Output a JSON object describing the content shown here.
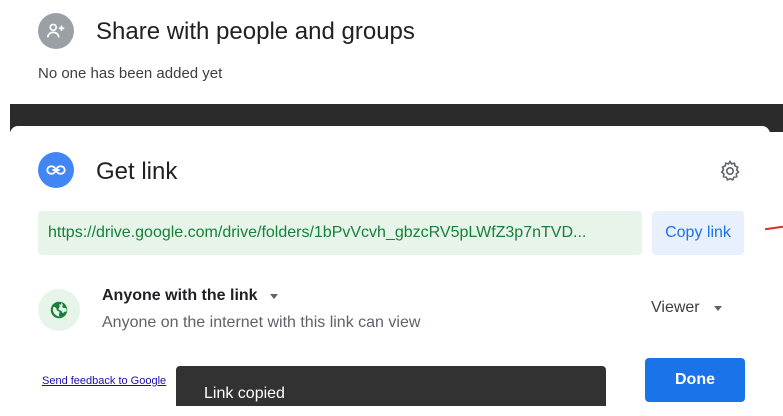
{
  "share_section": {
    "title": "Share with people and groups",
    "empty_message": "No one has been added yet",
    "icon": "add-person-icon"
  },
  "link_section": {
    "title": "Get link",
    "icon": "link-icon",
    "settings_icon": "gear-icon",
    "url": "https://drive.google.com/drive/folders/1bPvVcvh_gbzcRV5pLWfZ3p7nTVD...",
    "copy_label": "Copy link",
    "access": {
      "label": "Anyone with the link",
      "description": "Anyone on the internet with this link can view",
      "icon": "globe-icon"
    },
    "role": "Viewer"
  },
  "footer": {
    "feedback_label": "Send feedback to Google",
    "done_label": "Done"
  },
  "snackbar": {
    "message": "Link copied"
  },
  "colors": {
    "accent": "#1a73e8",
    "link_green": "#188038",
    "link_bg": "#e6f4ea",
    "copy_bg": "#e8f0fe",
    "snackbar_bg": "#323232",
    "backdrop": "#2b2b2b"
  }
}
